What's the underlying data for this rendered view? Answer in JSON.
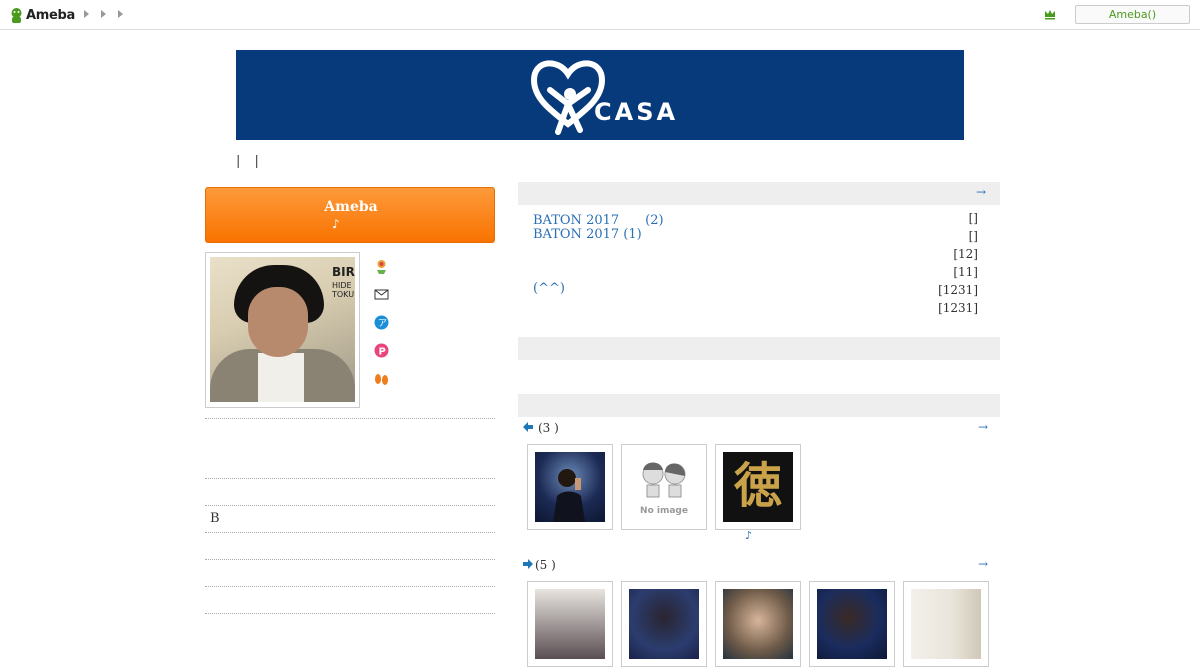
{
  "header": {
    "logo_text": "Ameba",
    "login_label": "Ameba()"
  },
  "banner": {
    "text": "CASA"
  },
  "pipes": [
    "|",
    "|"
  ],
  "sidebar": {
    "ameba_button": {
      "line1": "Ameba",
      "line2": "♪"
    },
    "b_label": "B",
    "profile_icons": [
      "flower-icon",
      "mail-icon",
      "app-icon",
      "p-icon",
      "footprints-icon"
    ],
    "photo_text": "BIR",
    "photo_subtext": "HIDE\nTOKU"
  },
  "recent": {
    "more_arrow": "→",
    "entries": [
      {
        "title": "BATON 2017　　(2)",
        "meta": "[]"
      },
      {
        "title": "BATON  2017 (1)",
        "meta": "[]"
      },
      {
        "title": "",
        "meta": "[12]"
      },
      {
        "title": "",
        "meta": "[11]"
      },
      {
        "title": "(^^)",
        "meta": "[1231]"
      },
      {
        "title": "",
        "meta": "[1231]"
      }
    ]
  },
  "gallery1": {
    "title": "(3 )",
    "more_arrow": "→",
    "caption": "♪",
    "thumbs": [
      "singer-photo",
      "no-image",
      "kanji-toku"
    ],
    "no_image_text": "No image",
    "kanji": "徳"
  },
  "gallery2": {
    "title": "(5 )",
    "more_arrow": "→",
    "thumbs": [
      "photo-1",
      "photo-2",
      "photo-3",
      "photo-4",
      "photo-5"
    ]
  },
  "colors": {
    "accent_orange": "#f97300",
    "link_blue": "#2a6fb5",
    "banner_navy": "#063a7a",
    "ameba_green": "#4a9b1d"
  }
}
